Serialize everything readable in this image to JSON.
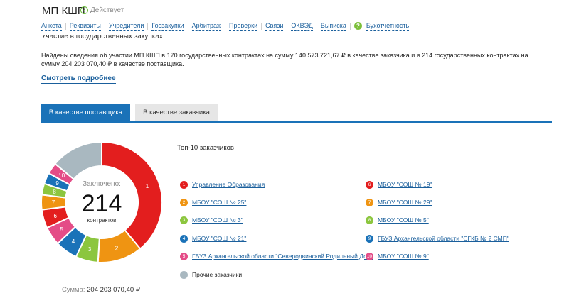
{
  "header": {
    "title": "МП КШП",
    "status": "Действует",
    "nav": [
      "Анкета",
      "Реквизиты",
      "Учредители",
      "Госзакупки",
      "Арбитраж",
      "Проверки",
      "Связи",
      "ОКВЭД",
      "Выписка",
      "Бухотчетность"
    ],
    "help_glyph": "?"
  },
  "section": {
    "title": "Участие в государственных закупках",
    "summary": "Найдены сведения об участии МП КШП в 170 государственных контрактах на сумму 140 573 721,67 ₽ в качестве заказчика и в 214 государственных контрактах на сумму 204 203 070,40 ₽ в качестве поставщика.",
    "more_link": "Смотреть подробнее"
  },
  "tabs": [
    "В качестве поставщика",
    "В качестве заказчика"
  ],
  "chart": {
    "center_label": "Заключено:",
    "center_value": "214",
    "center_unit": "контрактов",
    "top_title": "Топ-10 заказчиков",
    "sum_label": "Сумма:",
    "sum_value": "204 203 070,40 ₽"
  },
  "chart_data": {
    "type": "pie",
    "categories": [
      "1",
      "2",
      "3",
      "4",
      "5",
      "6",
      "7",
      "8",
      "9",
      "10",
      "other"
    ],
    "values": [
      39,
      12,
      6,
      6,
      5,
      5,
      4,
      3,
      3,
      3,
      14
    ],
    "colors": [
      "#e31e1e",
      "#ef9412",
      "#8cc63f",
      "#1a72b8",
      "#e44c87",
      "#e31e1e",
      "#ef9412",
      "#8cc63f",
      "#1a72b8",
      "#e44c87",
      "#a9b8c0"
    ]
  },
  "legend": [
    {
      "num": "1",
      "label": "Управление Образования",
      "color": "#e31e1e"
    },
    {
      "num": "2",
      "label": "МБОУ \"СОШ № 25\"",
      "color": "#ef9412"
    },
    {
      "num": "3",
      "label": "МБОУ \"СОШ № 3\"",
      "color": "#8cc63f"
    },
    {
      "num": "4",
      "label": "МБОУ \"СОШ № 21\"",
      "color": "#1a72b8"
    },
    {
      "num": "5",
      "label": "ГБУЗ Архангельской области \"Северодвинский Родильный Дом\"",
      "color": "#e44c87"
    },
    {
      "num": "6",
      "label": "МБОУ \"СОШ № 19\"",
      "color": "#e31e1e"
    },
    {
      "num": "7",
      "label": "МБОУ \"СОШ № 29\"",
      "color": "#ef9412"
    },
    {
      "num": "8",
      "label": "МБОУ \"СОШ № 5\"",
      "color": "#8cc63f"
    },
    {
      "num": "9",
      "label": "ГБУЗ Архангельской области \"СГКБ № 2 СМП\"",
      "color": "#1a72b8"
    },
    {
      "num": "10",
      "label": "МБОУ \"СОШ № 9\"",
      "color": "#e44c87"
    },
    {
      "num": "",
      "label": "Прочие заказчики",
      "color": "#a9b8c0"
    }
  ]
}
